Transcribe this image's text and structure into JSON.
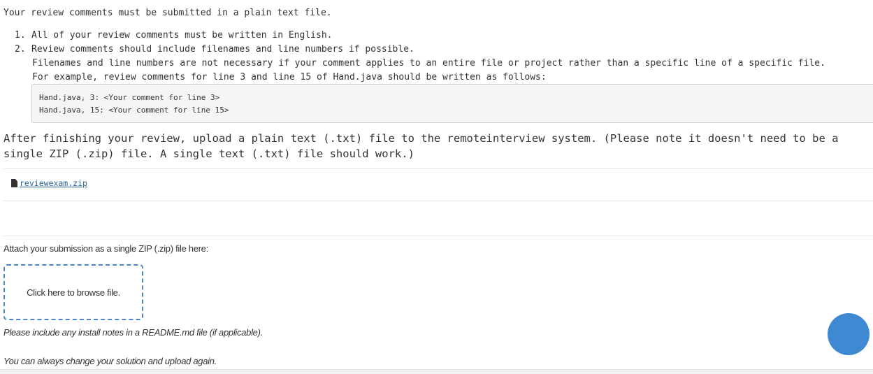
{
  "instructions": {
    "intro": "Your review comments must be submitted in a plain text file.",
    "items": [
      {
        "number": "1.",
        "text": "All of your review comments must be written in English."
      },
      {
        "number": "2.",
        "text": "Review comments should include filenames and line numbers if possible."
      }
    ],
    "item2_extra_1": "Filenames and line numbers are not necessary if your comment applies to an entire file or project rather than a specific line of a specific file.",
    "item2_extra_2": "For example, review comments for line 3 and line 15 of Hand.java should be written as follows:",
    "code_lines": [
      "Hand.java, 3: <Your comment for line 3>",
      "Hand.java, 15: <Your comment for line 15>"
    ]
  },
  "upload_note": "After finishing your review, upload a plain text (.txt) file to the remoteinterview system. (Please note it doesn't need to be a single ZIP (.zip) file. A single text (.txt) file should work.)",
  "attachment": {
    "icon": "file-icon",
    "filename": "reviewexam.zip"
  },
  "submission": {
    "label": "Attach your submission as a single ZIP (.zip) file here:",
    "browse_text": "Click here to browse file.",
    "readme_note": "Please include any install notes in a README.md file (if applicable).",
    "change_note": "You can always change your solution and upload again."
  },
  "colors": {
    "link": "#2a6496",
    "dropzone_border": "#4a86c7",
    "fab": "#3f88d2"
  }
}
